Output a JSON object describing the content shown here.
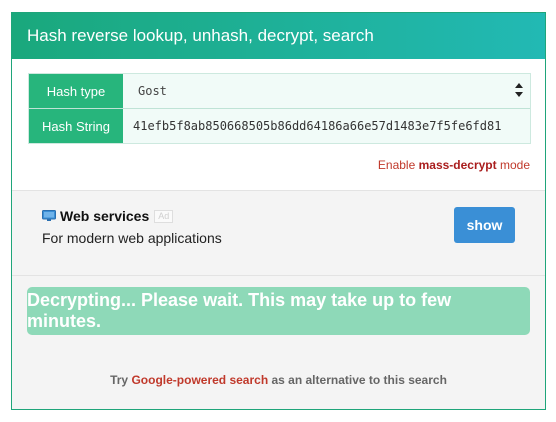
{
  "header": {
    "title": "Hash reverse lookup, unhash, decrypt, search"
  },
  "form": {
    "hash_type_label": "Hash type",
    "hash_type_value": "Gost",
    "hash_string_label": "Hash String",
    "hash_string_value": "41efb5f8ab850668505b86dd64186a66e57d1483e7f5fe6fd81"
  },
  "mass_decrypt": {
    "prefix": "Enable ",
    "link": "mass-decrypt",
    "suffix": " mode"
  },
  "ad": {
    "title": "Web services",
    "badge": "Ad",
    "description": "For modern web applications",
    "button_label": "show"
  },
  "status": {
    "message": "Decrypting... Please wait. This may take up to few minutes."
  },
  "alternative": {
    "prefix": "Try ",
    "link": "Google-powered search",
    "suffix": " as an alternative to this search"
  },
  "colors": {
    "accent": "#27b57c",
    "button_blue": "#3a8fd6",
    "link_red": "#c0392b",
    "progress_bg": "#8ed9b8"
  },
  "icons": [
    "monitor-icon",
    "select-arrows-icon"
  ]
}
